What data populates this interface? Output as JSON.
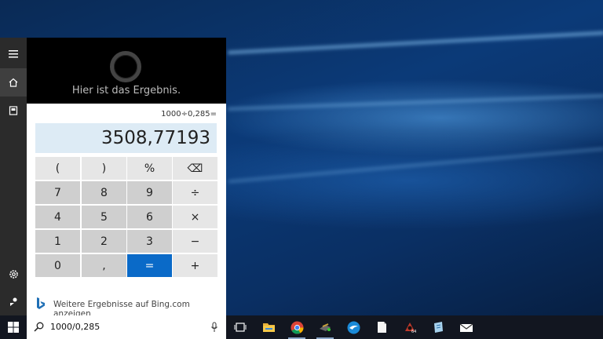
{
  "cortana": {
    "header_text": "Hier ist das Ergebnis."
  },
  "calculator": {
    "expression": "1000÷0,285=",
    "result": "3508,77193",
    "keys": [
      {
        "label": "(",
        "kind": "op"
      },
      {
        "label": ")",
        "kind": "op"
      },
      {
        "label": "%",
        "kind": "op"
      },
      {
        "label": "⌫",
        "kind": "op"
      },
      {
        "label": "7",
        "kind": "num"
      },
      {
        "label": "8",
        "kind": "num"
      },
      {
        "label": "9",
        "kind": "num"
      },
      {
        "label": "÷",
        "kind": "op"
      },
      {
        "label": "4",
        "kind": "num"
      },
      {
        "label": "5",
        "kind": "num"
      },
      {
        "label": "6",
        "kind": "num"
      },
      {
        "label": "×",
        "kind": "op"
      },
      {
        "label": "1",
        "kind": "num"
      },
      {
        "label": "2",
        "kind": "num"
      },
      {
        "label": "3",
        "kind": "num"
      },
      {
        "label": "−",
        "kind": "op"
      },
      {
        "label": "0",
        "kind": "num"
      },
      {
        "label": ",",
        "kind": "num"
      },
      {
        "label": "=",
        "kind": "eq"
      },
      {
        "label": "+",
        "kind": "op"
      }
    ]
  },
  "bing": {
    "link_text": "Weitere Ergebnisse auf Bing.com anzeigen"
  },
  "search": {
    "value": "1000/0,285"
  },
  "rail": {
    "items": [
      "hamburger-menu-icon",
      "home-icon",
      "notebook-icon",
      "settings-icon",
      "feedback-icon"
    ]
  },
  "taskbar": {
    "apps": [
      "task-view-icon",
      "file-explorer-icon",
      "chrome-icon",
      "app-icon",
      "edge-bird-icon",
      "document-icon",
      "game-icon",
      "notepad-icon",
      "mail-icon"
    ]
  },
  "colors": {
    "accent": "#0a6ac8",
    "display_bg": "#ddebf5"
  }
}
